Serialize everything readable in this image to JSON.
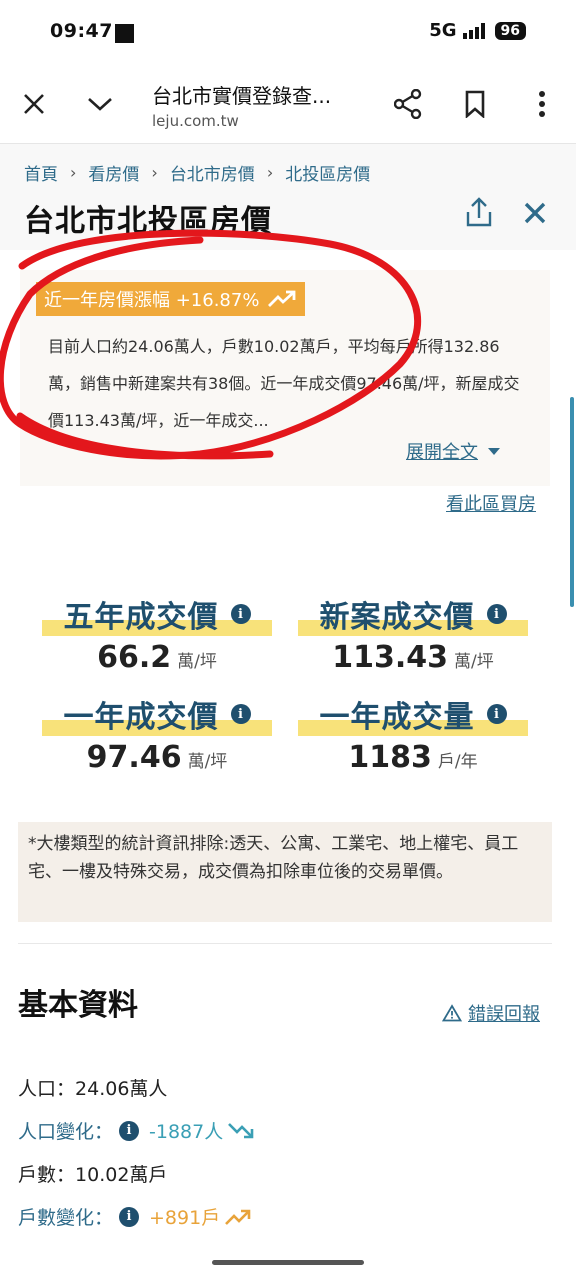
{
  "status_bar": {
    "time": "09:47",
    "network": "5G",
    "battery": "96"
  },
  "browser": {
    "title": "台北市實價登錄查...",
    "url": "leju.com.tw"
  },
  "breadcrumb": [
    "首頁",
    "看房價",
    "台北市房價",
    "北投區房價"
  ],
  "page_title": "台北市北投區房價",
  "summary": {
    "badge": "近一年房價漲幅 +16.87%",
    "text": "目前人口約24.06萬人，戶數10.02萬戶，平均每戶所得132.86萬，銷售中新建案共有38個。近一年成交價97.46萬/坪，新屋成交價113.43萬/坪，近一年成交...",
    "expand": "展開全文"
  },
  "buy_link": "看此區買房",
  "stats": [
    {
      "title": "五年成交價",
      "value": "66.2",
      "unit": "萬/坪"
    },
    {
      "title": "新案成交價",
      "value": "113.43",
      "unit": "萬/坪"
    },
    {
      "title": "一年成交價",
      "value": "97.46",
      "unit": "萬/坪"
    },
    {
      "title": "一年成交量",
      "value": "1183",
      "unit": "戶/年"
    }
  ],
  "note": "*大樓類型的統計資訊排除:透天、公寓、工業宅、地上權宅、員工宅、一樓及特殊交易，成交價為扣除車位後的交易單價。",
  "basic": {
    "title": "基本資料",
    "report": "錯誤回報",
    "population_label": "人口：",
    "population": "24.06萬人",
    "population_change_label": "人口變化：",
    "population_change": "-1887人",
    "households_label": "戶數：",
    "households": "10.02萬戶",
    "households_change_label": "戶數變化：",
    "households_change": "+891戶"
  },
  "colors": {
    "accent": "#f0a93a",
    "link": "#2f6b8a",
    "title": "#1f4f6e",
    "highlight": "#f8e27a",
    "annotation": "#e3171c"
  }
}
